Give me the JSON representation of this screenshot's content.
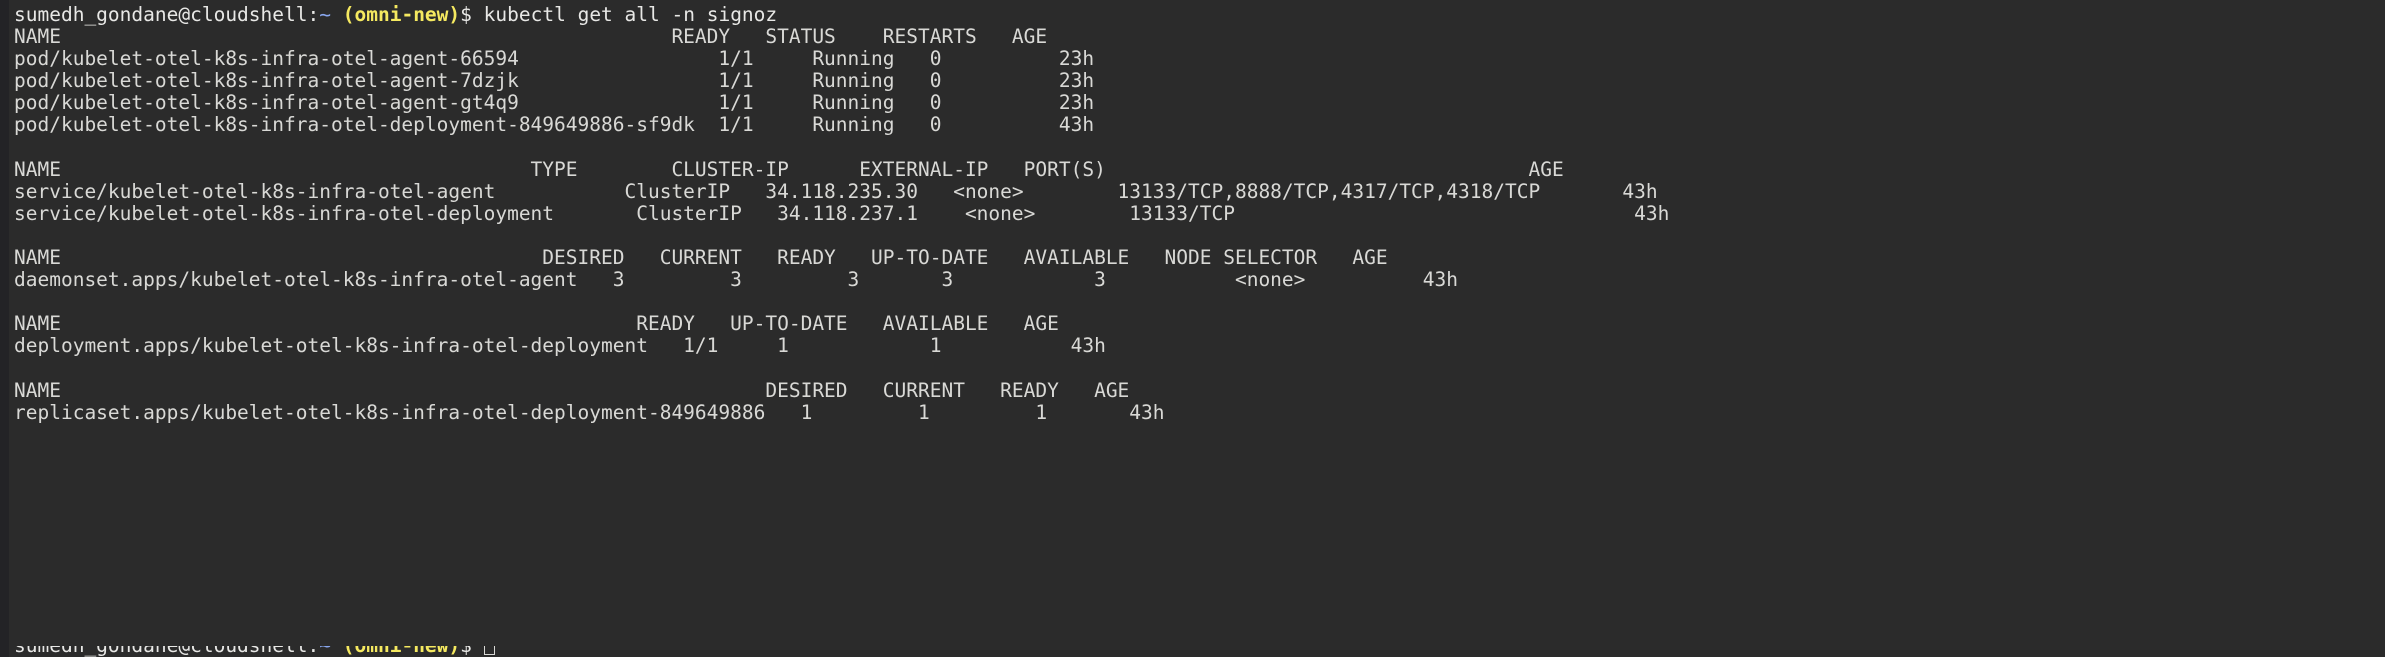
{
  "terminal": {
    "background_color": "#2b2b2b",
    "foreground_color": "#d9d9d6",
    "accent_yellow": "#f5e960",
    "accent_blue": "#8aa8f0"
  },
  "prompt": {
    "user_host": "sumedh_gondane@cloudshell",
    "separator": ":",
    "path": "~",
    "project": "(omni-new)",
    "dollar": "$",
    "command": "kubectl get all -n signoz"
  },
  "sections": [
    {
      "id": "pods",
      "header": "NAME                                                    READY   STATUS    RESTARTS   AGE",
      "rows": [
        "pod/kubelet-otel-k8s-infra-otel-agent-66594                 1/1     Running   0          23h",
        "pod/kubelet-otel-k8s-infra-otel-agent-7dzjk                 1/1     Running   0          23h",
        "pod/kubelet-otel-k8s-infra-otel-agent-gt4q9                 1/1     Running   0          23h",
        "pod/kubelet-otel-k8s-infra-otel-deployment-849649886-sf9dk  1/1     Running   0          43h"
      ]
    },
    {
      "id": "services",
      "header": "NAME                                        TYPE        CLUSTER-IP      EXTERNAL-IP   PORT(S)                                    AGE",
      "rows": [
        "service/kubelet-otel-k8s-infra-otel-agent           ClusterIP   34.118.235.30   <none>        13133/TCP,8888/TCP,4317/TCP,4318/TCP       43h",
        "service/kubelet-otel-k8s-infra-otel-deployment       ClusterIP   34.118.237.1    <none>        13133/TCP                                  43h"
      ]
    },
    {
      "id": "daemonsets",
      "header": "NAME                                         DESIRED   CURRENT   READY   UP-TO-DATE   AVAILABLE   NODE SELECTOR   AGE",
      "rows": [
        "daemonset.apps/kubelet-otel-k8s-infra-otel-agent   3         3         3       3            3           <none>          43h"
      ]
    },
    {
      "id": "deployments",
      "header": "NAME                                                 READY   UP-TO-DATE   AVAILABLE   AGE",
      "rows": [
        "deployment.apps/kubelet-otel-k8s-infra-otel-deployment   1/1     1            1           43h"
      ]
    },
    {
      "id": "replicasets",
      "header": "NAME                                                            DESIRED   CURRENT   READY   AGE",
      "rows": [
        "replicaset.apps/kubelet-otel-k8s-infra-otel-deployment-849649886   1         1         1       43h"
      ]
    }
  ],
  "bottom_prompt": {
    "user_host": "sumedh_gondane@cloudshell",
    "separator": ":",
    "path": "~",
    "project": "(omni-new)",
    "dollar": "$"
  },
  "columns": {
    "pods": [
      "NAME",
      "READY",
      "STATUS",
      "RESTARTS",
      "AGE"
    ],
    "services": [
      "NAME",
      "TYPE",
      "CLUSTER-IP",
      "EXTERNAL-IP",
      "PORT(S)",
      "AGE"
    ],
    "daemonsets": [
      "NAME",
      "DESIRED",
      "CURRENT",
      "READY",
      "UP-TO-DATE",
      "AVAILABLE",
      "NODE SELECTOR",
      "AGE"
    ],
    "deployments": [
      "NAME",
      "READY",
      "UP-TO-DATE",
      "AVAILABLE",
      "AGE"
    ],
    "replicasets": [
      "NAME",
      "DESIRED",
      "CURRENT",
      "READY",
      "AGE"
    ]
  }
}
